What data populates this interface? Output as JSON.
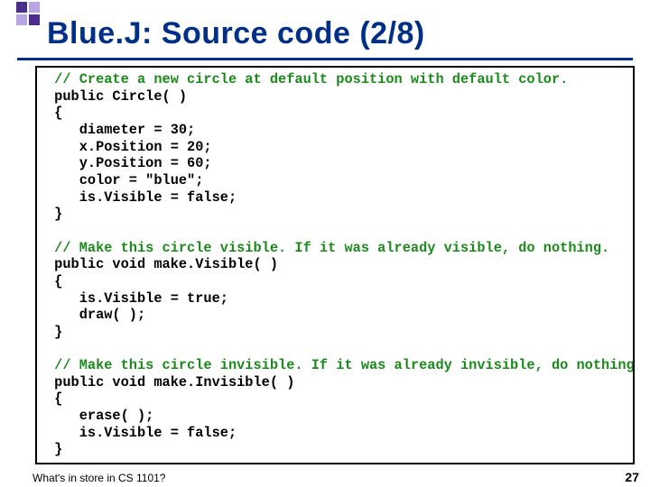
{
  "title": "Blue.J: Source code (2/8)",
  "code": {
    "block1": {
      "comment": " // Create a new circle at default position with default color.",
      "l1": " public Circle( )",
      "l2": " {",
      "l3": "    diameter = 30;",
      "l4": "    x.Position = 20;",
      "l5": "    y.Position = 60;",
      "l6": "    color = \"blue\";",
      "l7": "    is.Visible = false;",
      "l8": " }"
    },
    "block2": {
      "comment": " // Make this circle visible. If it was already visible, do nothing.",
      "l1": " public void make.Visible( )",
      "l2": " {",
      "l3": "    is.Visible = true;",
      "l4": "    draw( );",
      "l5": " }"
    },
    "block3": {
      "comment": " // Make this circle invisible. If it was already invisible, do nothing.",
      "l1": " public void make.Invisible( )",
      "l2": " {",
      "l3": "    erase( );",
      "l4": "    is.Visible = false;",
      "l5": " }"
    }
  },
  "footer": {
    "left": "What's in store in CS 1101?",
    "page": "27"
  }
}
